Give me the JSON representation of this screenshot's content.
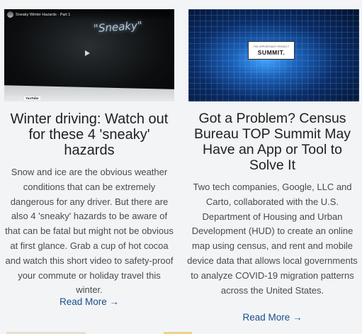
{
  "cards": [
    {
      "video_title": "Sneaky Winter Hazards - Part 1",
      "video_overlay": "\"Sneaky\"",
      "watch_on": "Watch on",
      "youtube": "YouTube",
      "title": "Winter driving: Watch out for these 4 'sneaky' hazards",
      "description": "Snow and ice are the obvious weather conditions that can be extremely dangerous for any driver. But there are also 4 'sneaky' hazards to be aware of that can be fatal but might not be obvious at first glance. Grab a cup of hot cocoa and watch this short video to safety-proof your commute or holiday travel this winter.",
      "read_more": "Read More →"
    },
    {
      "image_caption_small": "THE OPPORTUNITY PROJECT",
      "image_caption": "SUMMIT.",
      "title": "Got a Problem? Census Bureau TOP Summit May Have an App or Tool to Solve It",
      "description": "Two tech companies, Google, LLC and Carto, collaborated with the U.S. Department of Housing and Urban Development (HUD) to create an online map using census, and rent and mobile device data that allows local governments to analyze COVID-19 migration patterns across the United States.",
      "read_more": "Read More →"
    }
  ],
  "colors": {
    "link": "#1a4f8b",
    "title": "#1f1f1f",
    "text": "#4a4a4a",
    "background": "#f3f4f6"
  }
}
